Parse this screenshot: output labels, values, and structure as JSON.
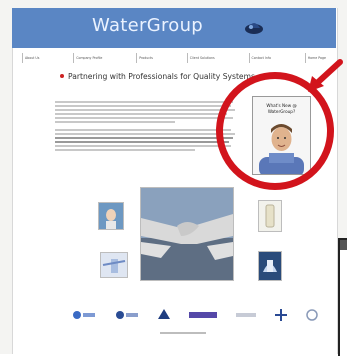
{
  "header": {
    "brand": "WaterGroup"
  },
  "nav": {
    "items": [
      "About Us",
      "Company Profile",
      "Products",
      "Client Solutions",
      "Contact Info",
      "Home Page"
    ]
  },
  "main": {
    "title": "Partnering with Professionals for Quality Systems"
  },
  "promo": {
    "text_line1": "What's New @",
    "text_line2": "WaterGroup?"
  },
  "colors": {
    "brand_blue": "#5a86c4",
    "highlight_red": "#d2141c"
  }
}
